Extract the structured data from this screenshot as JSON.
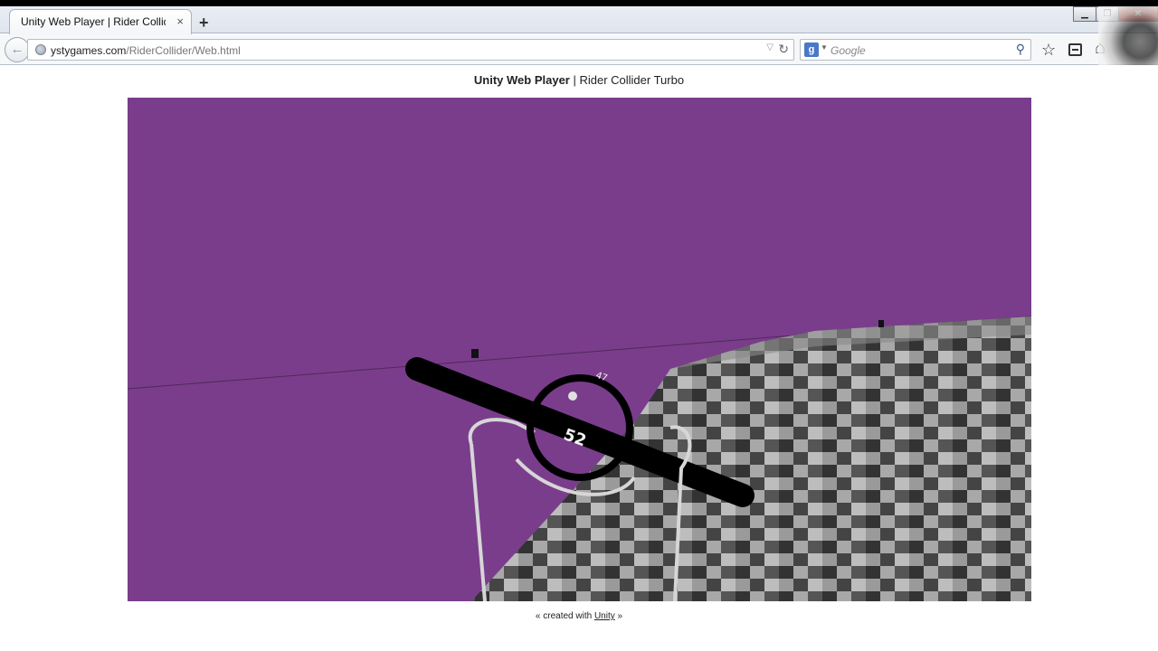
{
  "browser": {
    "tab_title": "Unity Web Player | Rider Collid...",
    "tab_close": "×",
    "new_tab": "+",
    "window_controls": [
      "▁",
      "❐",
      "✕"
    ],
    "url_domain": "ystygames.com",
    "url_path": "/RiderCollider/Web.html",
    "search_engine_letter": "g",
    "search_placeholder": "Google"
  },
  "page": {
    "title_bold": "Unity Web Player",
    "title_rest": " | Rider Collider Turbo",
    "footer_prefix": "« created with ",
    "footer_link": "Unity",
    "footer_suffix": " »"
  },
  "game": {
    "speed_readout": "52",
    "small_readout": "47",
    "sky_color": "#7a3d8b",
    "ground_colors": [
      "#3a3a3a",
      "#5a5a5a",
      "#777777",
      "#999999",
      "#bbbbbb"
    ]
  },
  "icons": [
    "back-arrow-icon",
    "globe-icon",
    "reload-icon",
    "google-icon",
    "magnifier-icon",
    "star-icon",
    "bookmarks-icon",
    "home-icon"
  ]
}
